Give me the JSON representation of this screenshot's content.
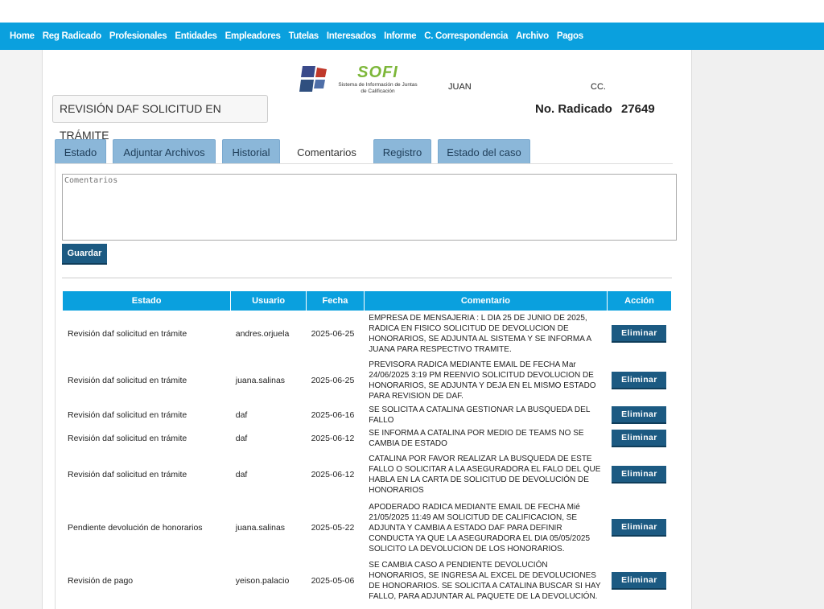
{
  "nav": [
    "Home",
    "Reg Radicado",
    "Profesionales",
    "Entidades",
    "Empleadores",
    "Tutelas",
    "Interesados",
    "Informe",
    "C. Correspondencia",
    "Archivo",
    "Pagos"
  ],
  "logo": {
    "name": "SOFI",
    "subtitle_line1": "Sistema de Información de Juntas",
    "subtitle_line2": "de Calificación"
  },
  "header": {
    "name": "JUAN",
    "doc_type": "CC.",
    "status": "REVISIÓN DAF SOLICITUD EN TRÁMITE",
    "radicado_label": "No. Radicado",
    "radicado_value": "27649"
  },
  "tabs": [
    "Estado",
    "Adjuntar Archivos",
    "Historial",
    "Comentarios",
    "Registro",
    "Estado del caso"
  ],
  "active_tab": "Comentarios",
  "comment_form": {
    "placeholder": "Comentarios",
    "save_label": "Guardar"
  },
  "table": {
    "headers": [
      "Estado",
      "Usuario",
      "Fecha",
      "Comentario",
      "Acción"
    ],
    "delete_label": "Eliminar",
    "rows": [
      {
        "estado": "Revisión daf solicitud en trámite",
        "usuario": "andres.orjuela",
        "fecha": "2025-06-25",
        "comentario": "EMPRESA DE MENSAJERIA : L DIA 25 DE JUNIO DE 2025, RADICA EN FISICO SOLICITUD DE DEVOLUCION DE HONORARIOS, SE ADJUNTA AL SISTEMA Y SE INFORMA A JUANA PARA RESPECTIVO TRAMITE."
      },
      {
        "estado": "Revisión daf solicitud en trámite",
        "usuario": "juana.salinas",
        "fecha": "2025-06-25",
        "comentario": "PREVISORA RADICA MEDIANTE EMAIL DE FECHA Mar 24/06/2025 3:19 PM REENVIO SOLICITUD DEVOLUCION DE HONORARIOS, SE ADJUNTA Y DEJA EN EL MISMO ESTADO PARA REVISION DE DAF."
      },
      {
        "estado": "Revisión daf solicitud en trámite",
        "usuario": "daf",
        "fecha": "2025-06-16",
        "comentario": "SE SOLICITA A CATALINA GESTIONAR LA BUSQUEDA DEL FALLO"
      },
      {
        "estado": "Revisión daf solicitud en trámite",
        "usuario": "daf",
        "fecha": "2025-06-12",
        "comentario": "SE INFORMA A CATALINA POR MEDIO DE TEAMS NO SE CAMBIA DE ESTADO"
      },
      {
        "estado": "Revisión daf solicitud en trámite",
        "usuario": "daf",
        "fecha": "2025-06-12",
        "comentario": "CATALINA POR FAVOR REALIZAR LA BUSQUEDA DE ESTE FALLO O SOLICITAR A LA ASEGURADORA EL FALO DEL QUE HABLA EN LA CARTA DE SOLICITUD DE DEVOLUCIÓN DE HONORARIOS"
      },
      {
        "estado": "Pendiente devolución de honorarios",
        "usuario": "juana.salinas",
        "fecha": "2025-05-22",
        "comentario": "APODERADO RADICA MEDIANTE EMAIL DE FECHA Mié 21/05/2025 11:49 AM SOLICITUD DE CALIFICACION, SE ADJUNTA Y CAMBIA A ESTADO DAF PARA DEFINIR CONDUCTA YA QUE LA ASEGURADORA EL DIA 05/05/2025 SOLICITO LA DEVOLUCION DE LOS HONORARIOS."
      },
      {
        "estado": "Revisión de pago",
        "usuario": "yeison.palacio",
        "fecha": "2025-05-06",
        "comentario": "SE CAMBIA CASO A PENDIENTE DEVOLUCIÓN HONORARIOS, SE INGRESA AL EXCEL DE DEVOLUCIONES DE HONORARIOS. SE SOLICITA A CATALINA BUSCAR SI HAY FALLO, PARA ADJUNTAR AL PAQUETE DE LA DEVOLUCIÓN."
      }
    ]
  },
  "colors": {
    "nav_bg": "#0aa0de",
    "tab_bg": "#8bb7d9",
    "button_bg": "#1c5a82",
    "logo_green": "#7db73a"
  }
}
